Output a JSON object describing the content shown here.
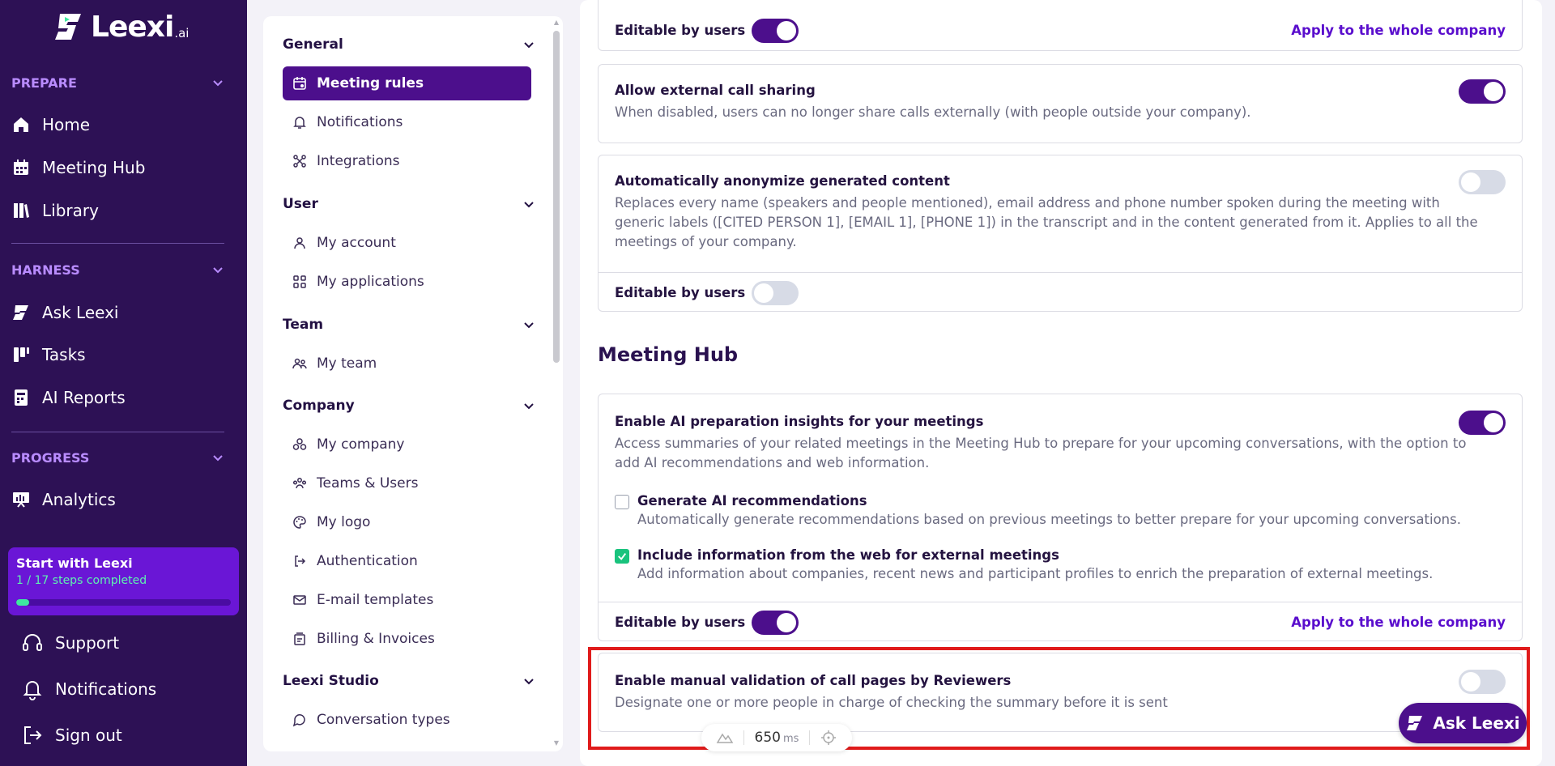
{
  "brand": {
    "name": "Leexi",
    "suffix": ".ai"
  },
  "sidebar": {
    "sections": [
      {
        "label": "PREPARE",
        "items": [
          {
            "label": "Home",
            "icon": "home-icon"
          },
          {
            "label": "Meeting Hub",
            "icon": "calendar-icon"
          },
          {
            "label": "Library",
            "icon": "library-icon"
          }
        ]
      },
      {
        "label": "HARNESS",
        "items": [
          {
            "label": "Ask Leexi",
            "icon": "leexi-icon"
          },
          {
            "label": "Tasks",
            "icon": "tasks-icon"
          },
          {
            "label": "AI Reports",
            "icon": "report-icon"
          }
        ]
      },
      {
        "label": "PROGRESS",
        "items": [
          {
            "label": "Analytics",
            "icon": "analytics-icon"
          }
        ]
      }
    ],
    "start_card": {
      "title": "Start with Leexi",
      "steps": "1 / 17 steps completed",
      "progress": 0.0588
    },
    "bottom": [
      {
        "label": "Support",
        "icon": "headset-icon"
      },
      {
        "label": "Notifications",
        "icon": "bell-icon"
      },
      {
        "label": "Sign out",
        "icon": "sign-out-icon"
      }
    ]
  },
  "settings_nav": {
    "groups": [
      {
        "label": "General",
        "items": [
          {
            "label": "Meeting rules",
            "icon": "calendar-rules-icon",
            "active": true
          },
          {
            "label": "Notifications",
            "icon": "bell-icon"
          },
          {
            "label": "Integrations",
            "icon": "integrations-icon"
          }
        ]
      },
      {
        "label": "User",
        "items": [
          {
            "label": "My account",
            "icon": "user-icon"
          },
          {
            "label": "My applications",
            "icon": "apps-icon"
          }
        ]
      },
      {
        "label": "Team",
        "items": [
          {
            "label": "My team",
            "icon": "team-icon"
          }
        ]
      },
      {
        "label": "Company",
        "items": [
          {
            "label": "My company",
            "icon": "company-icon"
          },
          {
            "label": "Teams & Users",
            "icon": "teams-users-icon"
          },
          {
            "label": "My logo",
            "icon": "palette-icon"
          },
          {
            "label": "Authentication",
            "icon": "auth-icon"
          },
          {
            "label": "E-mail templates",
            "icon": "mail-icon"
          },
          {
            "label": "Billing & Invoices",
            "icon": "billing-icon"
          }
        ]
      },
      {
        "label": "Leexi Studio",
        "items": [
          {
            "label": "Conversation types",
            "icon": "chat-icon"
          }
        ]
      }
    ]
  },
  "main": {
    "top_card": {
      "editable_label": "Editable by users",
      "editable": true,
      "apply_label": "Apply to the whole company"
    },
    "external_sharing": {
      "title": "Allow external call sharing",
      "desc": "When disabled, users can no longer share calls externally (with people outside your company).",
      "enabled": true
    },
    "anonymize": {
      "title": "Automatically anonymize generated content",
      "desc": "Replaces every name (speakers and people mentioned), email address and phone number spoken during the meeting with generic labels ([CITED PERSON 1], [EMAIL 1], [PHONE 1]) in the transcript and in the content generated from it. Applies to all the meetings of your company.",
      "enabled": false,
      "editable_label": "Editable by users",
      "editable": false
    },
    "meeting_hub_title": "Meeting Hub",
    "ai_insights": {
      "title": "Enable AI preparation insights for your meetings",
      "desc": "Access summaries of your related meetings in the Meeting Hub to prepare for your upcoming conversations, with the option to add AI recommendations and web information.",
      "enabled": true,
      "options": [
        {
          "title": "Generate AI recommendations",
          "desc": "Automatically generate recommendations based on previous meetings to better prepare for your upcoming conversations.",
          "checked": false
        },
        {
          "title": "Include information from the web for external meetings",
          "desc": "Add information about companies, recent news and participant profiles to enrich the preparation of external meetings.",
          "checked": true
        }
      ],
      "editable_label": "Editable by users",
      "editable": true,
      "apply_label": "Apply to the whole company"
    },
    "manual_validation": {
      "title": "Enable manual validation of call pages by Reviewers",
      "desc": "Designate one or more people in charge of checking the summary before it is sent",
      "enabled": false
    }
  },
  "ask_button": {
    "label": "Ask Leexi"
  },
  "latency": {
    "value": "650",
    "unit": "ms"
  },
  "colors": {
    "sidebar_bg": "#2d1155",
    "accent": "#4c0f8c",
    "link": "#5a0ecd",
    "highlight": "#e01b1b",
    "success": "#19c37d"
  }
}
